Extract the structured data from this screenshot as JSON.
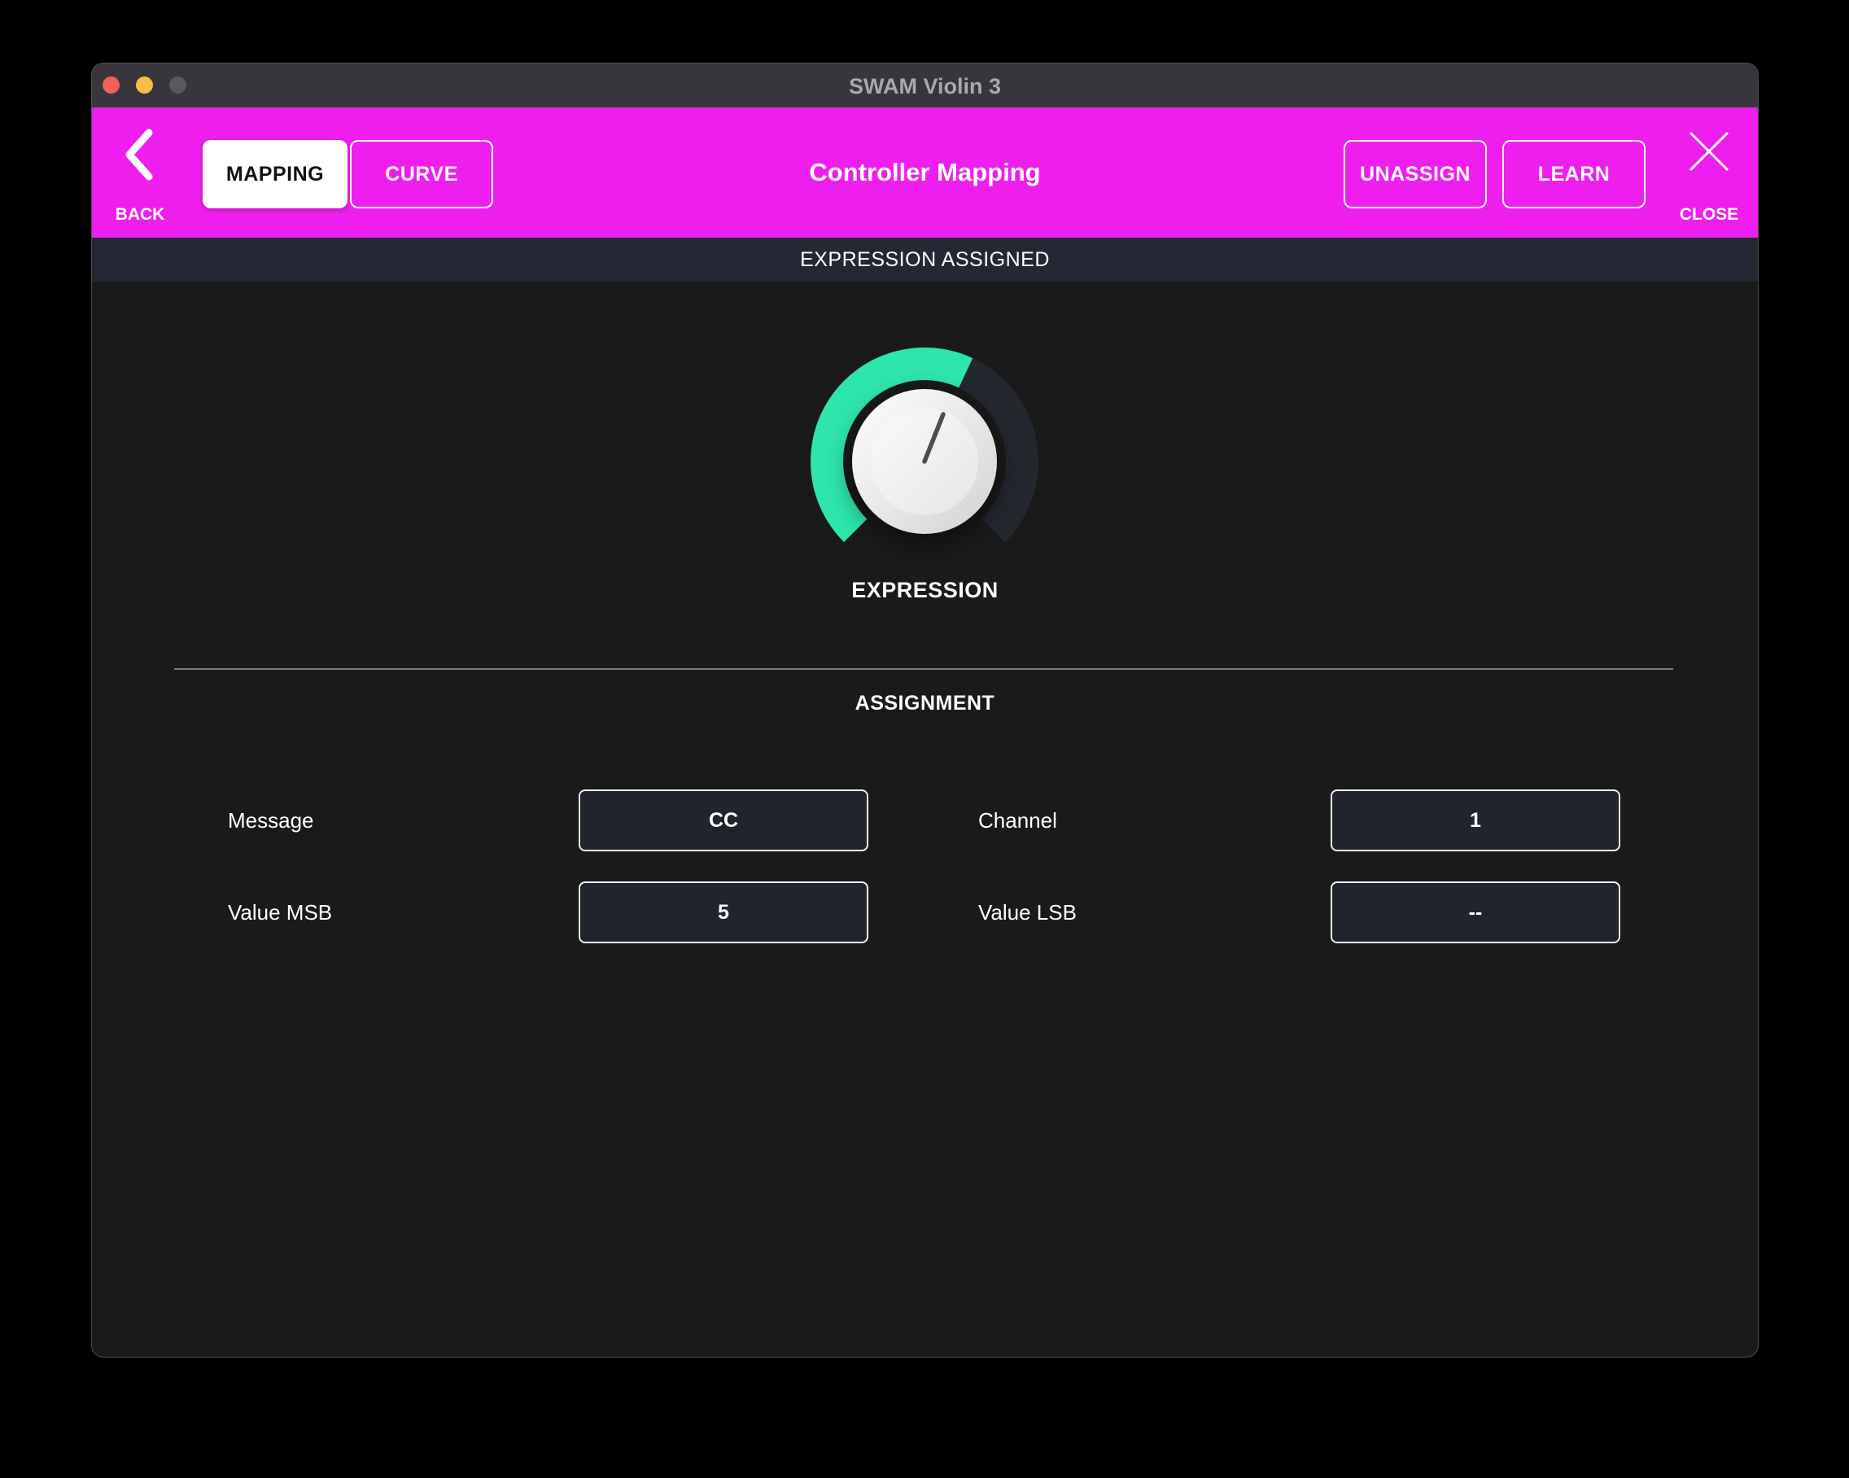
{
  "window": {
    "title": "SWAM Violin 3"
  },
  "header": {
    "back_label": "BACK",
    "tabs": [
      {
        "label": "MAPPING",
        "active": true
      },
      {
        "label": "CURVE",
        "active": false
      }
    ],
    "title": "Controller Mapping",
    "unassign_label": "UNASSIGN",
    "learn_label": "LEARN",
    "close_label": "CLOSE"
  },
  "status_bar": {
    "text": "EXPRESSION ASSIGNED"
  },
  "knob": {
    "label": "EXPRESSION",
    "value_percent": 59,
    "arc_color": "#2ee6ac",
    "track_color": "#23272e"
  },
  "assignment": {
    "heading": "ASSIGNMENT",
    "fields": [
      {
        "label": "Message",
        "value": "CC"
      },
      {
        "label": "Channel",
        "value": "1"
      },
      {
        "label": "Value MSB",
        "value": "5"
      },
      {
        "label": "Value LSB",
        "value": "--"
      }
    ]
  },
  "colors": {
    "accent_magenta": "#ee1fee",
    "knob_value_teal": "#2ee6ac",
    "knob_track": "#23272e",
    "status_bar_bg": "#232834",
    "field_box_bg": "#20242c",
    "field_border": "#f2f2f2",
    "traffic_red": "#f2605a",
    "traffic_yellow": "#f7bd44",
    "traffic_gray": "#5b585f"
  }
}
